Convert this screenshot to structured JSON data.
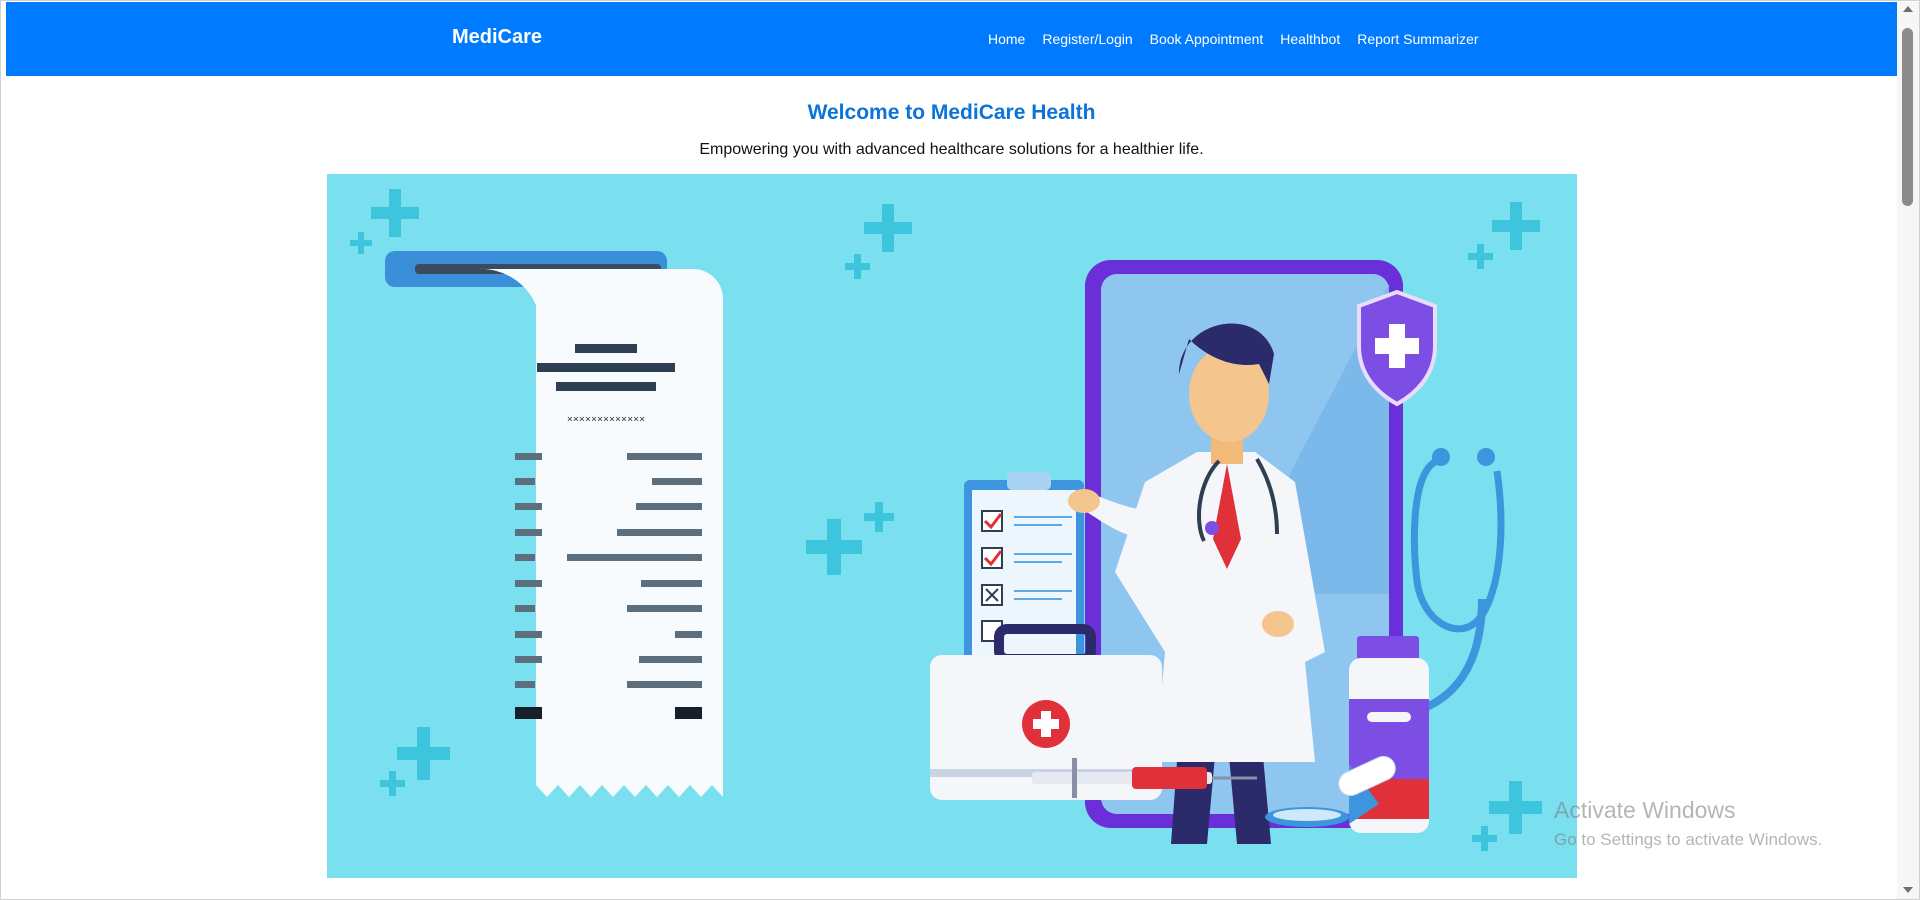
{
  "navbar": {
    "brand": "MediCare",
    "links": [
      "Home",
      "Register/Login",
      "Book Appointment",
      "Healthbot",
      "Report Summarizer"
    ]
  },
  "hero": {
    "title": "Welcome to MediCare Health",
    "subtitle": "Empowering you with advanced healthcare solutions for a healthier life.",
    "receipt_code": "×××××××××××××"
  },
  "watermark": {
    "title": "Activate Windows",
    "subtitle": "Go to Settings to activate Windows."
  },
  "colors": {
    "navbar": "#007bff",
    "title": "#0a74da",
    "hero_bg": "#7adfee",
    "plus": "#3cc5dd",
    "purple": "#6a2fd8"
  }
}
